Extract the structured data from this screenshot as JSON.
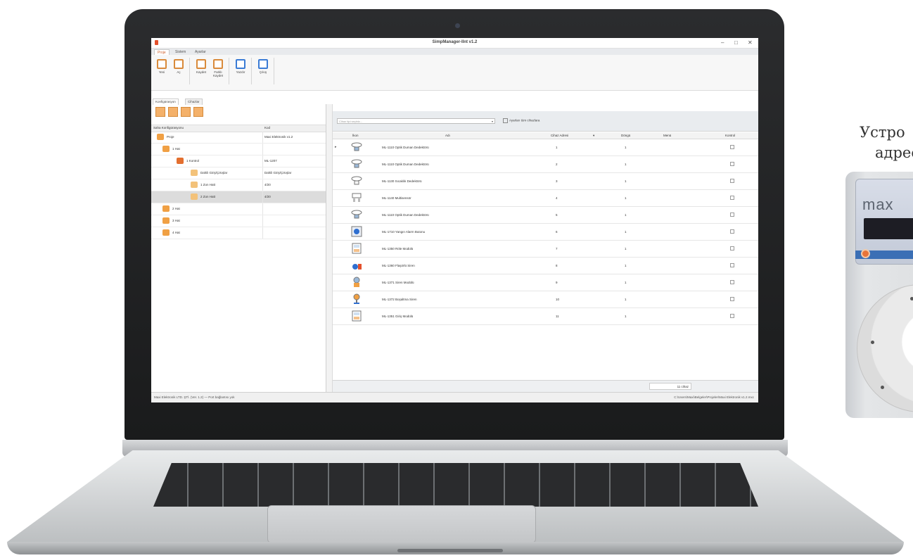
{
  "window": {
    "title": "SimpManager-IInt v1.2",
    "controls": [
      "–",
      "□",
      "✕"
    ]
  },
  "menu_tabs": [
    {
      "label": "Proje",
      "active": true
    },
    {
      "label": "Sistem",
      "active": false
    },
    {
      "label": "Ayarlar",
      "active": false
    }
  ],
  "ribbon": {
    "buttons": [
      {
        "label": "Yeni",
        "icon": "new-icon"
      },
      {
        "label": "Aç",
        "icon": "open-folder-icon"
      },
      {
        "label": "Kaydet",
        "icon": "save-icon"
      },
      {
        "label": "Farklı Kaydet",
        "icon": "save-as-icon"
      },
      {
        "label": "Yazdır",
        "icon": "print-icon"
      },
      {
        "label": "Çıkış",
        "icon": "exit-icon"
      }
    ]
  },
  "left_panel": {
    "tabs": [
      "Konfigürasyon",
      "Cihazlar"
    ],
    "columns": {
      "name": "Saha Konfigürasyonu",
      "value": "Kod"
    },
    "tree": [
      {
        "name": "Proje",
        "value": "Maxi Elektronik v1.2"
      },
      {
        "name": "1 Hat",
        "value": ""
      },
      {
        "name": "1 Kontrol",
        "value": "ML-1207"
      },
      {
        "name": "Dahili Giriş/Çıkışlar",
        "value": "Dahili Giriş/Çıkışlar"
      },
      {
        "name": "1 Zon Hatt",
        "value": "4/20"
      },
      {
        "name": "2 Zon Hatt",
        "value": "4/20"
      },
      {
        "name": "2 Hat",
        "value": ""
      },
      {
        "name": "3 Hat",
        "value": ""
      },
      {
        "name": "4 Hat",
        "value": ""
      }
    ]
  },
  "right_panel": {
    "combo_placeholder": "Cihaz tipi seçiniz...",
    "checkbox_label": "Ayarları tüm cihazlara",
    "columns": [
      "İkon",
      "Adı",
      "Cihaz Adresi",
      "Döngü",
      "Menü",
      "Kontrol"
    ],
    "devices": [
      {
        "name": "ML-1110 Optik Duman Dedektörü",
        "address": "1",
        "loop": "1"
      },
      {
        "name": "ML-1110 Optik Duman Dedektörü",
        "address": "2",
        "loop": "1"
      },
      {
        "name": "ML-1130 Sıcaklık Dedektörü",
        "address": "3",
        "loop": "1"
      },
      {
        "name": "ML-1140 Multisensör",
        "address": "4",
        "loop": "1"
      },
      {
        "name": "ML-1110 Optik Duman Dedektörü",
        "address": "5",
        "loop": "1"
      },
      {
        "name": "ML-1710 Yangın Alarm Butonu",
        "address": "6",
        "loop": "1"
      },
      {
        "name": "ML-1350 Röle Modülü",
        "address": "7",
        "loop": "1"
      },
      {
        "name": "ML-1360 Flaşörlü Siren",
        "address": "8",
        "loop": "1"
      },
      {
        "name": "ML-1371 Siren Modülü",
        "address": "9",
        "loop": "1"
      },
      {
        "name": "ML-1372 Boşaltma Siren",
        "address": "10",
        "loop": "1"
      },
      {
        "name": "ML-1351 Giriş Modülü",
        "address": "11",
        "loop": "1"
      }
    ],
    "footer_value": "11 cihaz"
  },
  "status": {
    "left": "Maxi Elektronik LTD. ŞTİ. (Ver. 1.2) — Port bağlantısı yok",
    "right": "C:\\Users\\Maxi\\Belgeler\\Projeler\\Maxi Elektronik v1.2.mxc"
  },
  "caption": {
    "line1": "Устро",
    "line2": "адрес"
  },
  "device_brand": "max"
}
